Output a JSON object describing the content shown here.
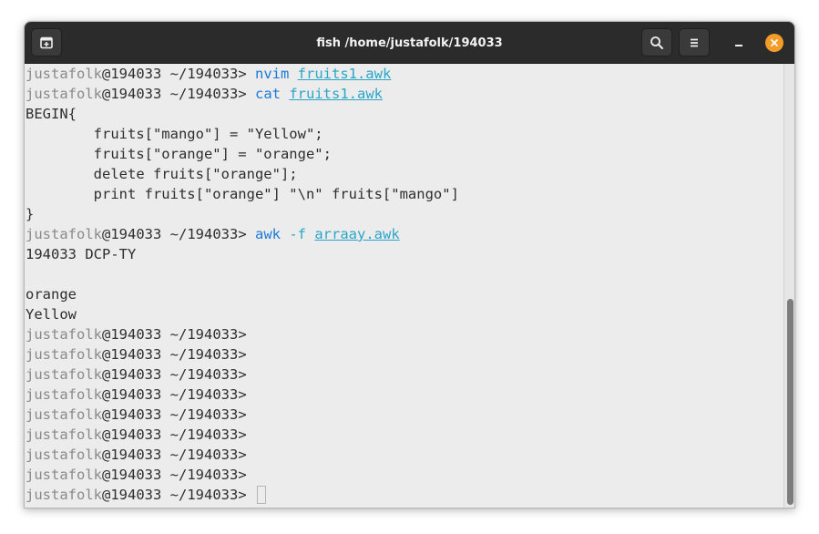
{
  "window": {
    "title": "fish /home/justafolk/194033"
  },
  "icons": {
    "new_tab": "new-tab-icon",
    "search": "search-icon",
    "menu": "hamburger-menu-icon",
    "minimize": "minimize-icon",
    "close": "close-icon"
  },
  "colors": {
    "titlebar": "#2b2b2b",
    "terminal_bg": "#ececec",
    "user_gray": "#8a8a8a",
    "command_blue": "#1b7bd6",
    "path_cyan": "#2aa6c8",
    "close_orange": "#f39c28"
  },
  "prompt": {
    "user": "justafolk",
    "host": "@194033",
    "dir": " ~/194033> "
  },
  "terminal": {
    "cmd1": {
      "command": "nvim",
      "file": "fruits1.awk"
    },
    "cmd2": {
      "command": "cat",
      "file": "fruits1.awk"
    },
    "cat_output": [
      "BEGIN{",
      "        fruits[\"mango\"] = \"Yellow\";",
      "        fruits[\"orange\"] = \"orange\";",
      "        delete fruits[\"orange\"];",
      "        print fruits[\"orange\"] \"\\n\" fruits[\"mango\"]",
      "}"
    ],
    "cmd3": {
      "command": "awk",
      "option": "-f",
      "file": "arraay.awk"
    },
    "awk_output": [
      "194033 DCP-TY",
      "",
      "orange",
      "Yellow"
    ]
  }
}
